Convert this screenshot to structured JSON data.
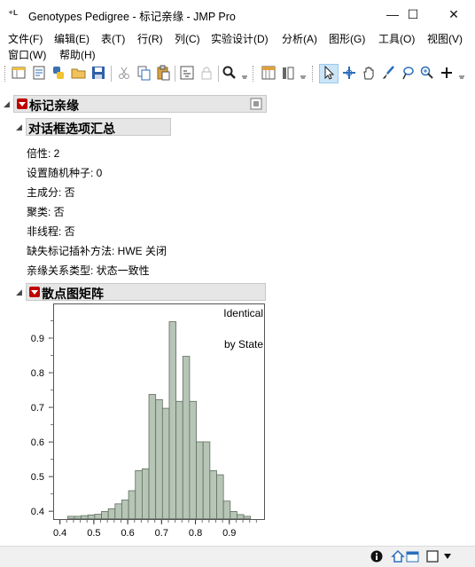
{
  "window": {
    "title": "Genotypes Pedigree - 标记亲缘 - JMP Pro",
    "minimize": "—",
    "maximize": "☐",
    "close": "✕"
  },
  "menubar": {
    "items": [
      "文件(F)",
      "编辑(E)",
      "表(T)",
      "行(R)",
      "列(C)",
      "实验设计(D)",
      "分析(A)",
      "图形(G)",
      "工具(O)",
      "视图(V)",
      "窗口(W)",
      "帮助(H)"
    ]
  },
  "report": {
    "main_title": "标记亲缘",
    "dialog_summary": {
      "title": "对话框选项汇总",
      "lines": [
        "倍性:  2",
        "设置随机种子:  0",
        "主成分:  否",
        "聚类:  否",
        "非线程:  否",
        "缺失标记插补方法:  HWE 关闭",
        "亲缘关系类型:  状态一致性"
      ]
    },
    "scatter_matrix": {
      "title": "散点图矩阵",
      "label_line1": "Identical",
      "label_line2": "by State"
    }
  },
  "chart_data": {
    "type": "bar",
    "subtype": "histogram",
    "title": "",
    "xlabel": "",
    "ylabel": "",
    "annotations": [
      "Identical",
      "by State"
    ],
    "x_ticks": [
      "0.4",
      "0.5",
      "0.6",
      "0.7",
      "0.8",
      "0.9"
    ],
    "y_ticks": [
      "0.4",
      "0.5",
      "0.6",
      "0.7",
      "0.8",
      "0.9"
    ],
    "xlim": [
      0.38,
      1.0
    ],
    "ylim": [
      0.38,
      1.0
    ],
    "bin_width": 0.02,
    "bins_start": [
      0.42,
      0.44,
      0.46,
      0.48,
      0.5,
      0.52,
      0.54,
      0.56,
      0.58,
      0.6,
      0.62,
      0.64,
      0.66,
      0.68,
      0.7,
      0.72,
      0.74,
      0.76,
      0.78,
      0.8,
      0.82,
      0.84,
      0.86,
      0.88,
      0.9,
      0.92,
      0.94
    ],
    "bar_tops": [
      0.388,
      0.388,
      0.39,
      0.392,
      0.394,
      0.402,
      0.41,
      0.424,
      0.435,
      0.462,
      0.52,
      0.525,
      0.74,
      0.725,
      0.7,
      0.95,
      0.72,
      0.85,
      0.72,
      0.603,
      0.603,
      0.52,
      0.508,
      0.432,
      0.402,
      0.393,
      0.388
    ],
    "color": "#b6c5b6",
    "grid": false
  },
  "statusbar": {
    "icons": [
      "info-icon",
      "home-icon",
      "window-icon",
      "dropdown-icon"
    ]
  },
  "colors": {
    "accent_red": "#c00000",
    "header_bg": "#e6e6e6",
    "bar_fill": "#b6c5b6"
  }
}
